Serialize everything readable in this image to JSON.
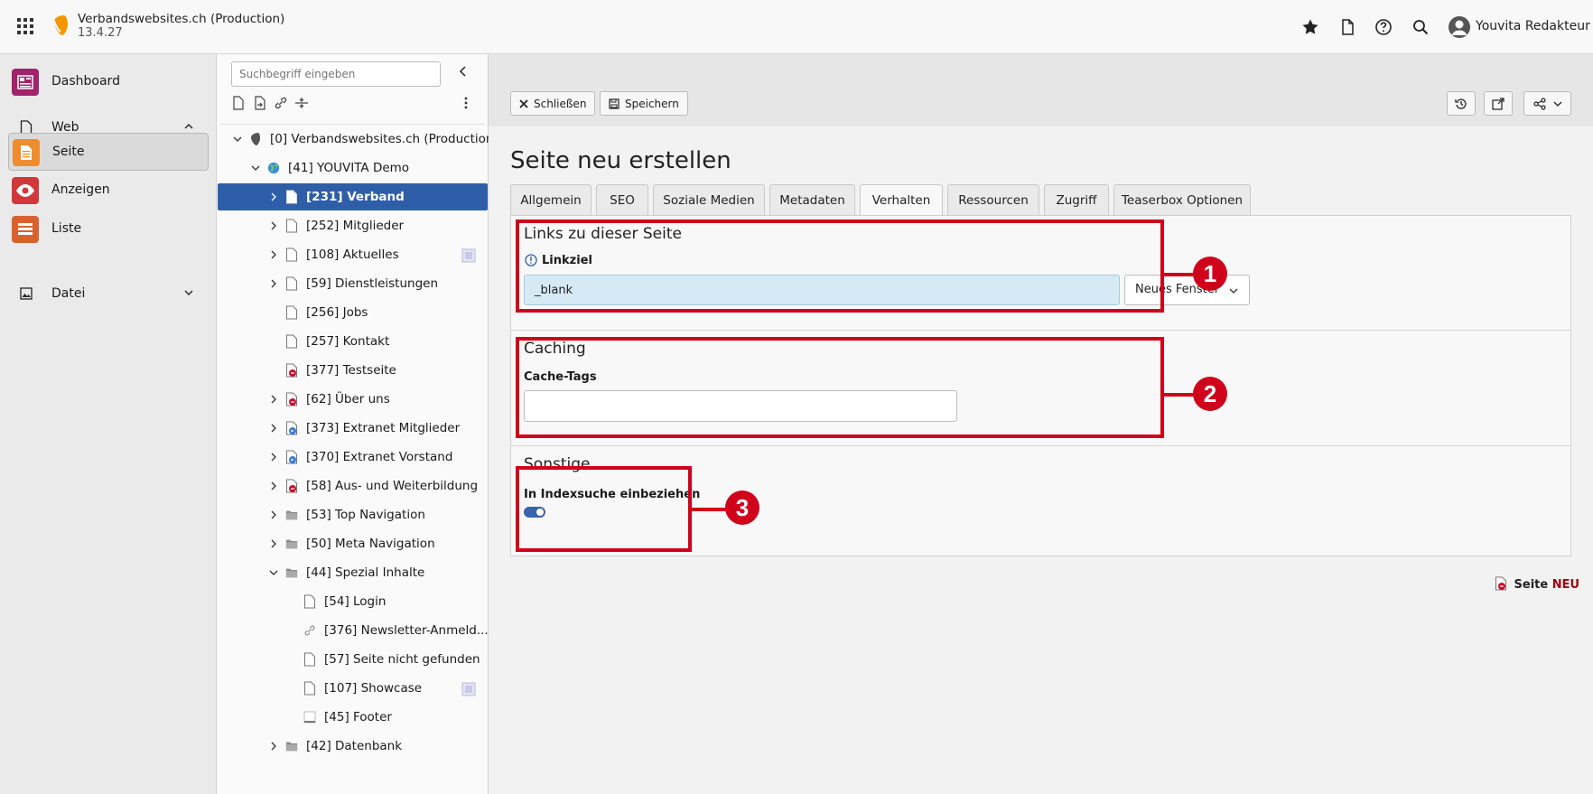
{
  "topbar": {
    "site_title": "Verbandswebsites.ch (Production)",
    "site_version": "13.4.27",
    "user_name": "Youvita Redakteur"
  },
  "modules": {
    "dashboard": "Dashboard",
    "web": "Web",
    "seite": "Seite",
    "anzeigen": "Anzeigen",
    "liste": "Liste",
    "datei": "Datei"
  },
  "tree": {
    "search_placeholder": "Suchbegriff eingeben",
    "nodes": [
      "[0] Verbandswebsites.ch (Production)",
      "[41] YOUVITA Demo",
      "[231] Verband",
      "[252] Mitglieder",
      "[108] Aktuelles",
      "[59] Dienstleistungen",
      "[256] Jobs",
      "[257] Kontakt",
      "[377] Testseite",
      "[62] Über uns",
      "[373] Extranet Mitglieder",
      "[370] Extranet Vorstand",
      "[58] Aus- und Weiterbildung",
      "[53] Top Navigation",
      "[50] Meta Navigation",
      "[44] Spezial Inhalte",
      "[54] Login",
      "[376] Newsletter-Anmeld...",
      "[57] Seite nicht gefunden",
      "[107] Showcase",
      "[45] Footer",
      "[42] Datenbank"
    ]
  },
  "docheader": {
    "close_label": "Schließen",
    "save_label": "Speichern"
  },
  "form": {
    "title": "Seite neu erstellen",
    "tabs": [
      "Allgemein",
      "SEO",
      "Soziale Medien",
      "Metadaten",
      "Verhalten",
      "Ressourcen",
      "Zugriff",
      "Teaserbox Optionen"
    ],
    "active_tab": "Verhalten",
    "sections": {
      "links_title": "Links zu dieser Seite",
      "linkziel_label": "Linkziel",
      "linkziel_value": "_blank",
      "linkziel_select": "Neues Fenster",
      "caching_title": "Caching",
      "cachetags_label": "Cache-Tags",
      "cachetags_value": "",
      "sonstige_title": "Sonstige",
      "index_label": "In Indexsuche einbeziehen",
      "index_enabled": true
    },
    "footer_label": "Seite",
    "footer_new": "NEU"
  },
  "annotations": [
    "1",
    "2",
    "3"
  ],
  "colors": {
    "accent": "#2f5ea8",
    "annotation": "#d0021b",
    "linkziel_bg": "#d5eaf5"
  }
}
